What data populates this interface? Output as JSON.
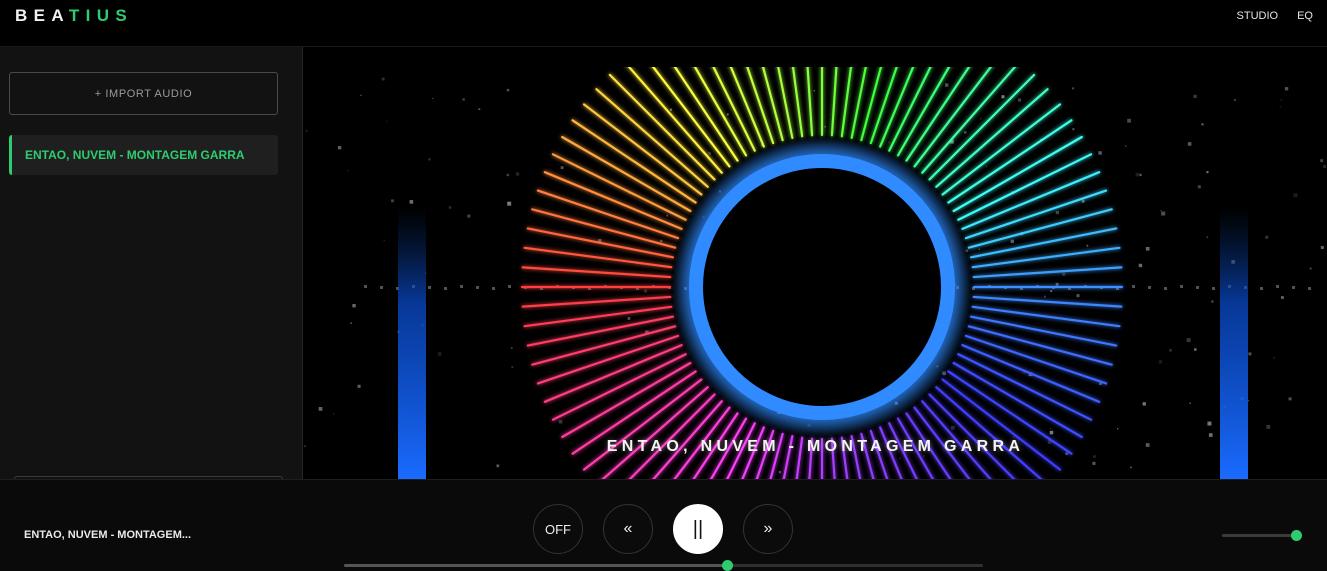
{
  "app": {
    "logo_part1": "BEA",
    "logo_part2": "TIUS",
    "nav": [
      "STUDIO",
      "EQ"
    ],
    "accent_color": "#2ecc71"
  },
  "sidebar": {
    "import_label": "+ IMPORT AUDIO",
    "tracks": [
      {
        "title": "ENTAO, NUVEM - MONTAGEM GARRA",
        "active": true
      }
    ]
  },
  "visualizer": {
    "track_title": "ENTAO, NUVEM - MONTAGEM GARRA",
    "ring_color": "#2f8bff"
  },
  "player": {
    "now_playing": "ENTAO, NUVEM - MONTAGEM...",
    "controls": {
      "off": "OFF",
      "prev": "«",
      "play_pause": "||",
      "next": "»"
    },
    "seek_fraction": 0.6,
    "volume_fraction": 1.0
  }
}
